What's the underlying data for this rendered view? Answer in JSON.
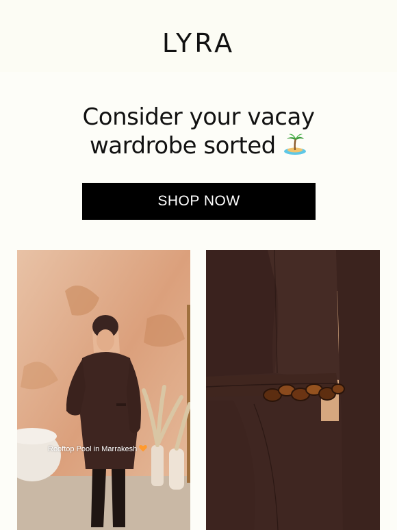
{
  "brand": {
    "name": "LYRA"
  },
  "hero": {
    "headline_line1": "Consider your vacay",
    "headline_line2": "wardrobe sorted",
    "emoji": "desert-island-icon"
  },
  "cta": {
    "label": "SHOP NOW"
  },
  "photos": [
    {
      "name": "model-photo",
      "caption": "Rooftop Pool in Marrakesh",
      "caption_icon": "orange-heart-icon"
    },
    {
      "name": "detail-photo",
      "caption": ""
    }
  ],
  "colors": {
    "background": "#fdfdf8",
    "button": "#000000",
    "button_text": "#ffffff",
    "garment": "#3e2520"
  }
}
